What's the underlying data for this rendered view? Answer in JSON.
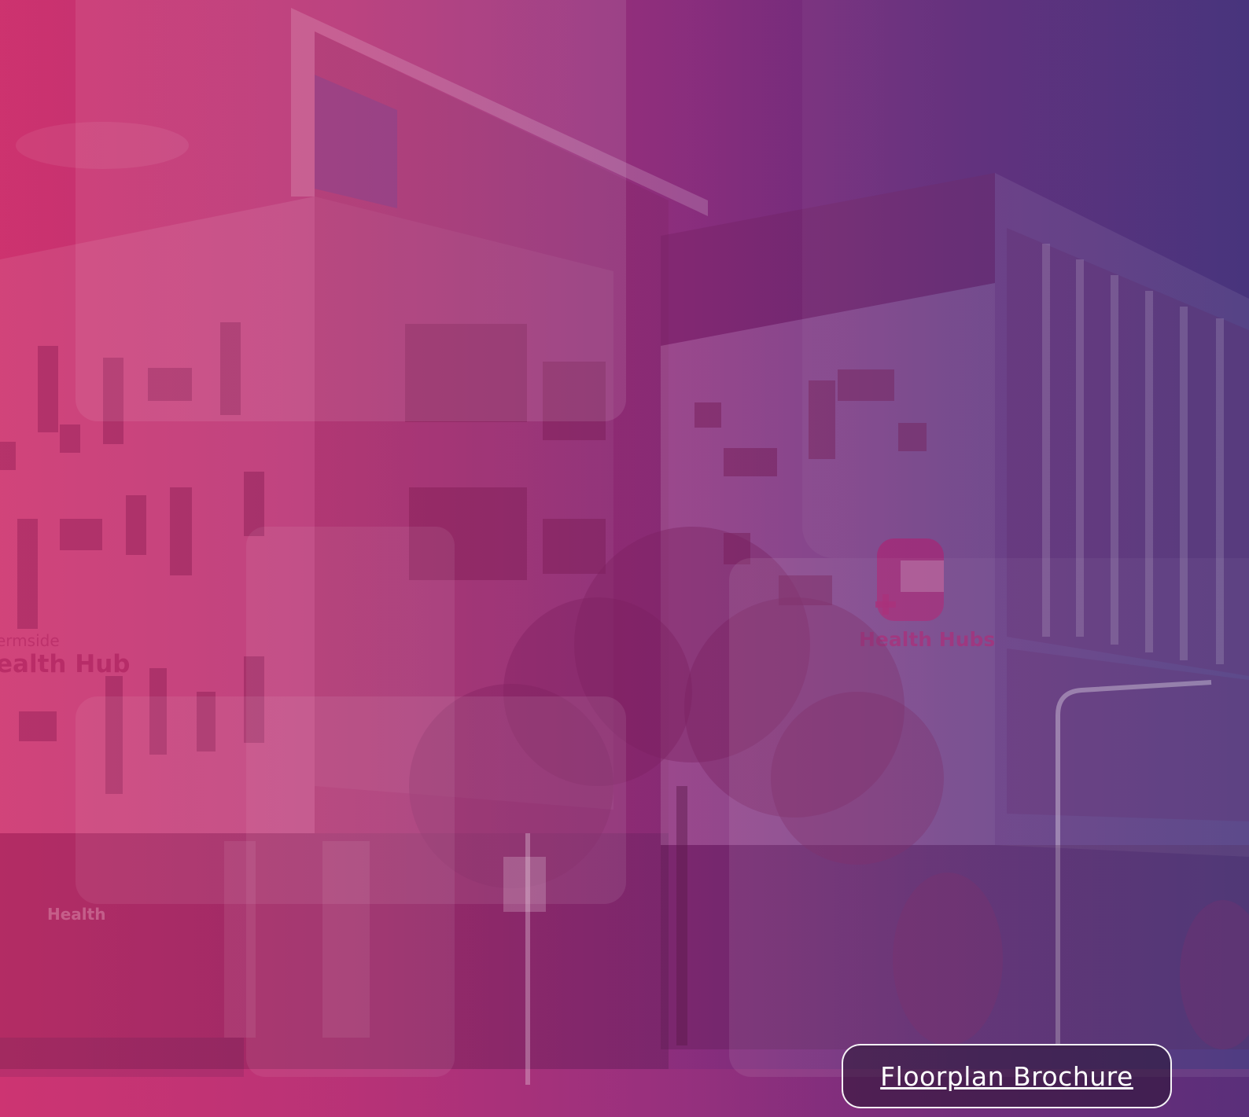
{
  "page": {
    "accent_colors": [
      "#c8326f",
      "#8b2f7e",
      "#3f2e78"
    ]
  },
  "signage": {
    "left_building_line1": "Chermside",
    "left_building_line2": "Health Hub",
    "right_building_logo": "Health Hubs",
    "street_sign_small": "Health Hub"
  },
  "cta": {
    "label": "Floorplan Brochure"
  },
  "icons": {
    "logo": "health-hubs-cross-logo-icon"
  }
}
